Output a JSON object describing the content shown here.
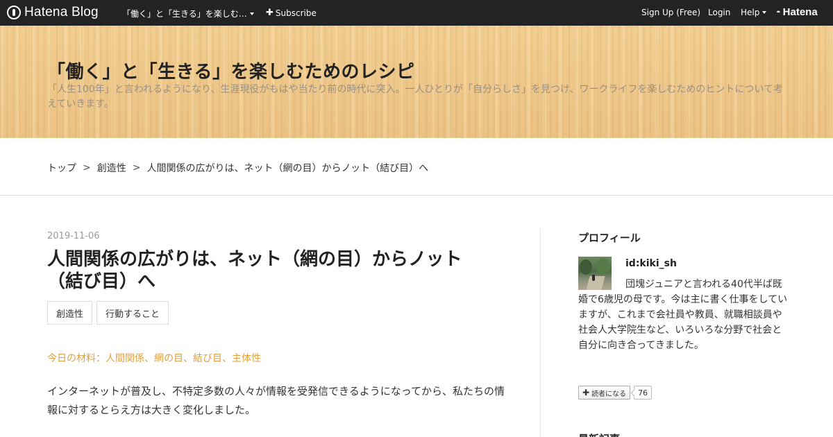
{
  "topbar": {
    "logo_text": "Hatena Blog",
    "blog_menu": "「働く」と「生きる」を楽しむ…",
    "subscribe": "Subscribe",
    "signup": "Sign Up (Free)",
    "login": "Login",
    "help": "Help",
    "brand": "Hatena"
  },
  "header": {
    "title": "「働く」と「生きる」を楽しむためのレシピ",
    "description": "「人生100年」と言われるようになり、生涯現役がもはや当たり前の時代に突入。一人ひとりが「自分らしさ」を見つけ、ワークライフを楽しむためのヒントについて考えていきます。"
  },
  "breadcrumb": [
    "トップ",
    "創造性",
    "人間関係の広がりは、ネット（網の目）からノット（結び目）へ"
  ],
  "breadcrumb_separator": ">",
  "entry": {
    "date": "2019-11-06",
    "title": "人間関係の広がりは、ネット（網の目）からノット（結び目）へ",
    "tags": [
      "創造性",
      "行動すること"
    ],
    "materials": "今日の材料：人間関係、網の目、結び目、主体性",
    "body": "インターネットが普及し、不特定多数の人々が情報を受発信できるようになってから、私たちの情報に対するとらえ方は大きく変化しました。"
  },
  "sidebar": {
    "profile_heading": "プロフィール",
    "user_id": "id:kiki_sh",
    "profile_text": "団塊ジュニアと言われる40代半ば既婚で6歳児の母です。今は主に書く仕事をしていますが、これまで会社員や教員、就職相談員や社会人大学院生など、いろいろな分野で社会と自分に向き合ってきました。",
    "reader_button": "読者になる",
    "reader_count": "76",
    "next_heading": "最新記事"
  }
}
